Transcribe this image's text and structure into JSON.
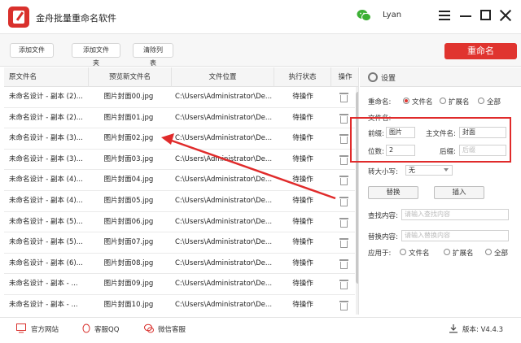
{
  "app": {
    "title": "金舟批量重命名软件",
    "user": "Lyan",
    "accent": "#e0342f"
  },
  "toolbar": {
    "add_file": "添加文件",
    "add_folder": "添加文件夹",
    "clear_list": "清除列表",
    "rename": "重命名"
  },
  "table": {
    "headers": [
      "原文件名",
      "预览新文件名",
      "文件位置",
      "执行状态",
      "操作"
    ],
    "rows": [
      [
        "未命名设计 - 副本 (2)...",
        "图片封面00.jpg",
        "C:\\Users\\Administrator\\De...",
        "待操作"
      ],
      [
        "未命名设计 - 副本 (2)...",
        "图片封面01.jpg",
        "C:\\Users\\Administrator\\De...",
        "待操作"
      ],
      [
        "未命名设计 - 副本 (3)...",
        "图片封面02.jpg",
        "C:\\Users\\Administrator\\De...",
        "待操作"
      ],
      [
        "未命名设计 - 副本 (3)...",
        "图片封面03.jpg",
        "C:\\Users\\Administrator\\De...",
        "待操作"
      ],
      [
        "未命名设计 - 副本 (4)...",
        "图片封面04.jpg",
        "C:\\Users\\Administrator\\De...",
        "待操作"
      ],
      [
        "未命名设计 - 副本 (4)...",
        "图片封面05.jpg",
        "C:\\Users\\Administrator\\De...",
        "待操作"
      ],
      [
        "未命名设计 - 副本 (5)...",
        "图片封面06.jpg",
        "C:\\Users\\Administrator\\De...",
        "待操作"
      ],
      [
        "未命名设计 - 副本 (5)...",
        "图片封面07.jpg",
        "C:\\Users\\Administrator\\De...",
        "待操作"
      ],
      [
        "未命名设计 - 副本 (6)...",
        "图片封面08.jpg",
        "C:\\Users\\Administrator\\De...",
        "待操作"
      ],
      [
        "未命名设计 - 副本 - ...",
        "图片封面09.jpg",
        "C:\\Users\\Administrator\\De...",
        "待操作"
      ],
      [
        "未命名设计 - 副本 - ...",
        "图片封面10.jpg",
        "C:\\Users\\Administrator\\De...",
        "待操作"
      ]
    ]
  },
  "settings": {
    "title": "设置",
    "rename_label": "重命名:",
    "opt_filename": "文件名",
    "opt_ext": "扩展名",
    "opt_all": "全部",
    "filename_label": "文件名:",
    "prefix_label": "前缀:",
    "prefix_value": "图片",
    "main_label": "主文件名:",
    "main_value": "封面",
    "digits_label": "位数:",
    "digits_value": "2",
    "suffix_label": "后缀:",
    "suffix_placeholder": "后缀",
    "case_label": "转大小写:",
    "case_value": "无",
    "replace_btn": "替换",
    "insert_btn": "插入",
    "find_label": "查找内容:",
    "find_placeholder": "请输入查找内容",
    "replace_label": "替换内容:",
    "replace_placeholder": "请输入替换内容",
    "apply_label": "应用于:",
    "apply_filename": "文件名",
    "apply_ext": "扩展名",
    "apply_all": "全部"
  },
  "status": {
    "website": "官方网站",
    "qq": "客服QQ",
    "wechat": "微信客服",
    "version": "版本: V4.4.3"
  }
}
